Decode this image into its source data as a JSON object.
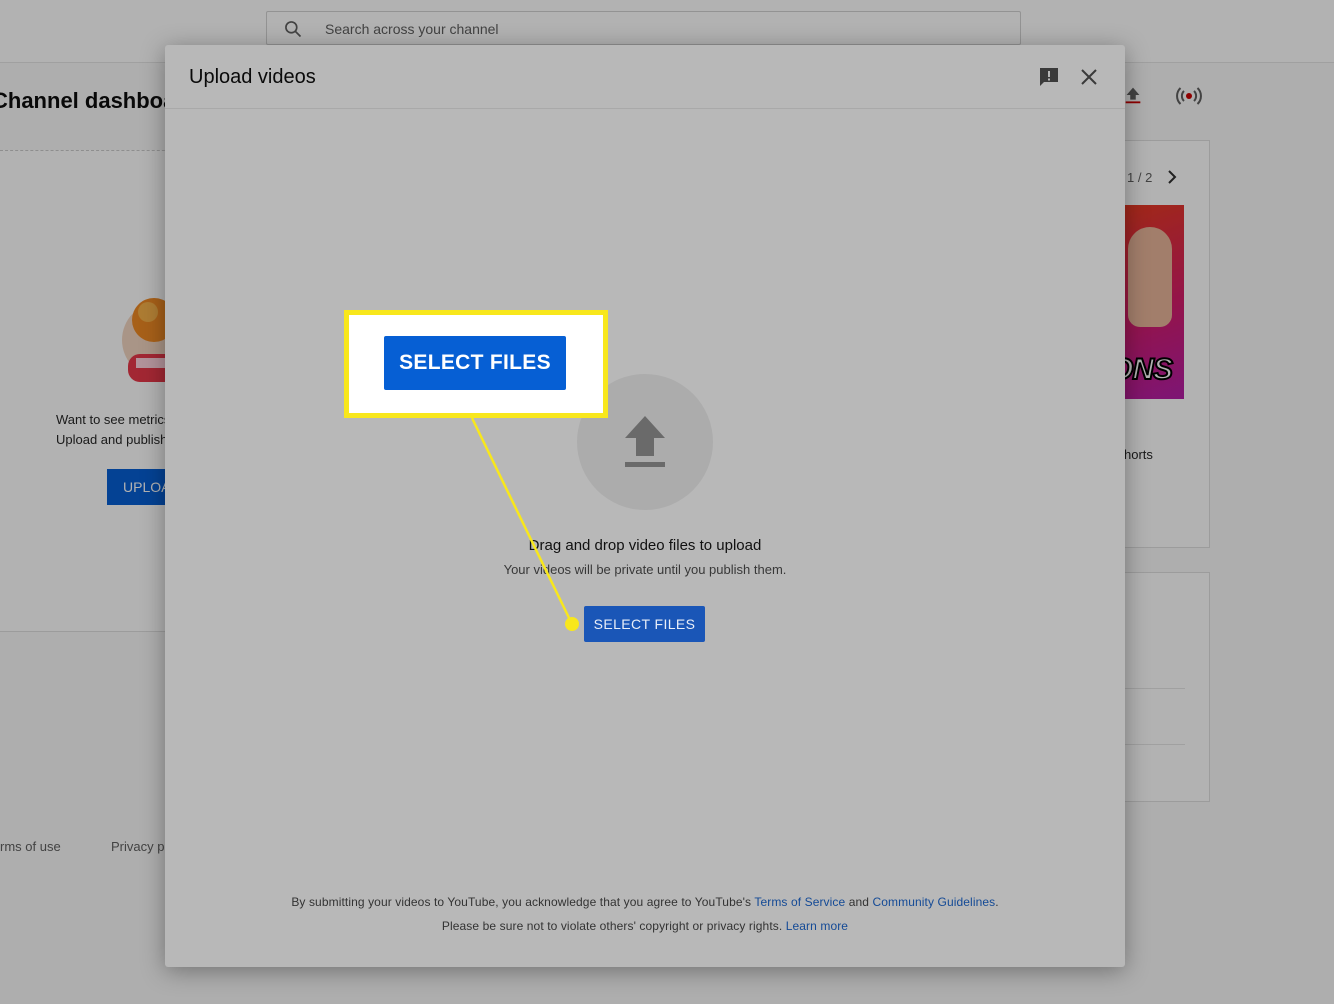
{
  "background": {
    "search": {
      "placeholder": "Search across your channel"
    },
    "dashboard_title": "Channel dashboard",
    "empty_state": {
      "line1": "Want to see metrics",
      "line2": "Upload and publish",
      "button_label": "UPLOAD"
    },
    "carousel": {
      "pager": "1 / 2",
      "thumbnail_text": "ONS",
      "caption": "horts"
    },
    "footer": {
      "terms": "rms of use",
      "privacy": "Privacy p"
    }
  },
  "dialog": {
    "title": "Upload videos",
    "drag_text": "Drag and drop video files to upload",
    "private_text": "Your videos will be private until you publish them.",
    "select_button_label": "SELECT FILES",
    "legal": {
      "line1_prefix": "By submitting your videos to YouTube, you acknowledge that you agree to YouTube's ",
      "terms_link": "Terms of Service",
      "and": " and ",
      "guidelines_link": "Community Guidelines",
      "line1_suffix": ".",
      "line2_prefix": "Please be sure not to violate others' copyright or privacy rights. ",
      "learn_more_link": "Learn more"
    }
  },
  "callout": {
    "button_label": "SELECT FILES",
    "color": "#f8e71c"
  },
  "icons": {
    "search": "search-icon",
    "header_upload": "upload-icon",
    "live": "live-broadcast-icon",
    "next": "chevron-right-icon",
    "feedback": "feedback-icon",
    "close": "close-icon",
    "upload_arrow": "upload-arrow-icon"
  },
  "colors": {
    "accent": "#065fd4",
    "link": "#065fd4",
    "callout": "#f8e71c"
  }
}
